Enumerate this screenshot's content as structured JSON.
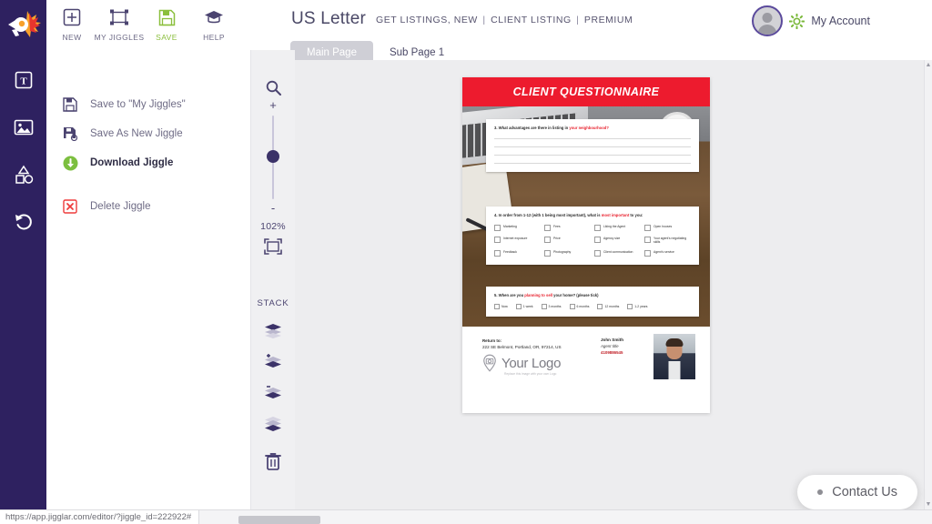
{
  "app": {
    "logo_icon": "jigglar-megaphone-icon"
  },
  "rail": {
    "items": [
      {
        "name": "text-tool",
        "icon": "text-box-icon"
      },
      {
        "name": "image-tool",
        "icon": "image-icon"
      },
      {
        "name": "shapes-tool",
        "icon": "shapes-icon"
      },
      {
        "name": "undo-tool",
        "icon": "undo-arrow-icon"
      }
    ]
  },
  "toolbar": {
    "items": [
      {
        "label": "NEW",
        "icon": "plus-square-icon"
      },
      {
        "label": "MY JIGGLES",
        "icon": "transform-frame-icon"
      },
      {
        "label": "SAVE",
        "icon": "floppy-disk-icon"
      },
      {
        "label": "HELP",
        "icon": "graduation-cap-icon"
      }
    ]
  },
  "header": {
    "title": "US Letter",
    "breadcrumbs": [
      "GET LISTINGS, NEW",
      "CLIENT LISTING",
      "PREMIUM"
    ],
    "separator": "|",
    "account_label": "My Account",
    "account_icon": "gear-icon",
    "avatar_icon": "user-avatar-icon"
  },
  "tabs": [
    {
      "label": "Main Page",
      "active": false
    },
    {
      "label": "Sub Page 1",
      "active": true
    }
  ],
  "sidebar": {
    "items": [
      {
        "label": "Save to \"My Jiggles\"",
        "icon": "floppy-disk-icon",
        "bold": false
      },
      {
        "label": "Save As New Jiggle",
        "icon": "floppy-disk-plus-icon",
        "bold": false
      },
      {
        "label": "Download Jiggle",
        "icon": "download-circle-icon",
        "bold": true
      },
      {
        "label": "Delete Jiggle",
        "icon": "delete-x-icon",
        "bold": false
      }
    ]
  },
  "zoom_panel": {
    "search_icon": "magnifier-icon",
    "plus": "+",
    "minus": "-",
    "zoom_level": "102%",
    "fit_icon": "fit-to-screen-icon",
    "stack_label": "STACK",
    "stack_buttons": [
      {
        "name": "bring-to-front",
        "icon": "layers-top-icon"
      },
      {
        "name": "bring-forward",
        "icon": "layers-up-icon"
      },
      {
        "name": "send-backward",
        "icon": "layers-down-icon"
      },
      {
        "name": "send-to-back",
        "icon": "layers-bottom-icon"
      }
    ],
    "delete_icon": "trash-icon"
  },
  "document": {
    "banner_title": "CLIENT QUESTIONNAIRE",
    "banner_color": "#ed1b2e",
    "questions": [
      {
        "number": "3.",
        "text_before": "What advantages are there in listing in ",
        "highlight": "your neighbourhood?",
        "text_after": "",
        "write_lines": 4
      },
      {
        "number": "4.",
        "text_before": "In order from 1-12 (with 1 being most important), what is ",
        "highlight": "most important",
        "text_after": " to you:",
        "options": [
          "Marketing",
          "Fees",
          "Liking the Agent",
          "Open houses",
          "Internet exposure",
          "Price",
          "Agency size",
          "Your agent's negotiating skills",
          "Feedback",
          "Photography",
          "Client communication",
          "Agent's service"
        ]
      },
      {
        "number": "5.",
        "text_before": "When are you ",
        "highlight": "planning to sell",
        "text_after": " your home? (please tick)",
        "options": [
          "Now",
          "1 week",
          "3 months",
          "6 months",
          "12 months",
          "1-2 years"
        ]
      }
    ],
    "footer": {
      "return_label": "Return to:",
      "return_address": "222 SE Belmont, Portland, OR, 97214, US",
      "logo_text": "Your Logo",
      "logo_sub": "Replace this image with your own Logo",
      "logo_icon": "location-pin-camera-icon",
      "agent_name": "John Smith",
      "agent_title": "Agent title",
      "agent_phone": "4109886545",
      "headshot_icon": "agent-headshot"
    }
  },
  "contact_widget": {
    "label": "Contact Us"
  },
  "status": {
    "url": "https://app.jigglar.com/editor/?jiggle_id=222922#"
  }
}
